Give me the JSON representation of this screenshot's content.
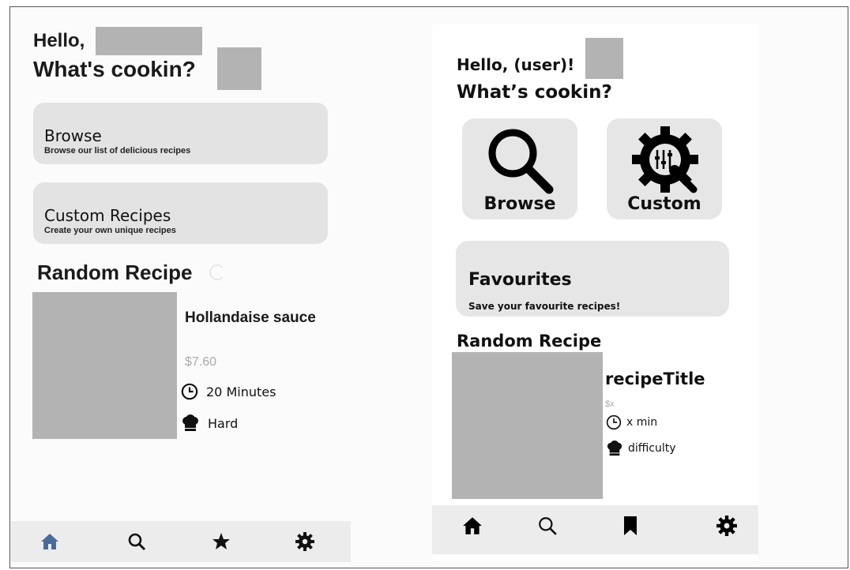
{
  "left": {
    "greeting": "Hello,",
    "prompt": "What's cookin?",
    "cards": [
      {
        "title": "Browse",
        "subtitle": "Browse our list of delicious recipes"
      },
      {
        "title": "Custom Recipes",
        "subtitle": "Create your own unique recipes"
      }
    ],
    "random_heading": "Random Recipe",
    "recipe": {
      "title": "Hollandaise sauce",
      "price": "$7.60",
      "time": "20 Minutes",
      "difficulty": "Hard"
    },
    "nav": [
      {
        "icon": "home-icon",
        "active": true
      },
      {
        "icon": "search-icon"
      },
      {
        "icon": "star-icon"
      },
      {
        "icon": "gear-icon"
      }
    ]
  },
  "right": {
    "greeting": "Hello, (user)!",
    "prompt": "What’s cookin?",
    "tiles": [
      {
        "label": "Browse",
        "icon": "search-icon"
      },
      {
        "label": "Custom",
        "icon": "gear-tools-icon"
      }
    ],
    "favourites": {
      "title": "Favourites",
      "subtitle": "Save your favourite recipes!"
    },
    "random_heading": "Random Recipe",
    "recipe": {
      "title": "recipeTitle",
      "price": "$x",
      "time": "x min",
      "difficulty": "difficulty"
    },
    "nav": [
      {
        "icon": "home-icon"
      },
      {
        "icon": "search-icon"
      },
      {
        "icon": "bookmark-icon"
      },
      {
        "icon": "gear-icon"
      }
    ]
  },
  "colors": {
    "active_nav": "#4a6a9a",
    "placeholder": "#b3b3b3",
    "card": "#e3e3e3",
    "price": "#aaaaaa"
  }
}
